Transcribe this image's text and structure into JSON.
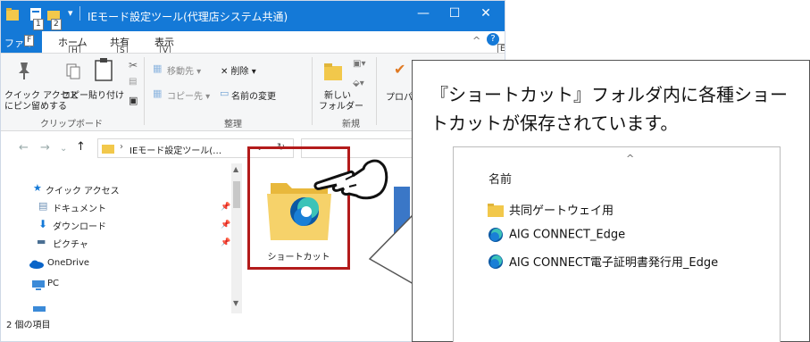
{
  "window": {
    "title": "IEモード設定ツール(代理店システム共通)",
    "qat_keytips": [
      "1",
      "2"
    ],
    "controls": [
      "—",
      "☐",
      "✕"
    ],
    "help_keytip": "E"
  },
  "ribbon_tabs": {
    "file": {
      "label": "ファイル",
      "keytip": "F"
    },
    "home": {
      "label": "ホーム",
      "keytip": "H"
    },
    "share": {
      "label": "共有",
      "keytip": "S"
    },
    "view": {
      "label": "表示",
      "keytip": "V"
    }
  },
  "ribbon": {
    "pin_quick_access": [
      "クイック アクセス",
      "にピン留めする"
    ],
    "copy": "コピー",
    "paste": "貼り付け",
    "move_to": "移動先 ▾",
    "delete": "✕ 削除 ▾",
    "copy_to": "コピー先 ▾",
    "rename": "名前の変更",
    "new_folder": [
      "新しい",
      "フォルダー"
    ],
    "properties": "プロパ",
    "group_clipboard": "クリップボード",
    "group_organize": "整理",
    "group_new": "新規"
  },
  "address": {
    "path": "IEモード設定ツール(…",
    "dropdown": "⌄",
    "refresh": "↻"
  },
  "nav": {
    "quick_access": "クイック アクセス",
    "documents": "ドキュメント",
    "downloads": "ダウンロード",
    "pictures": "ピクチャ",
    "onedrive": "OneDrive",
    "pc": "PC"
  },
  "content": {
    "folder_name": "ショートカット"
  },
  "status": {
    "item_count": "2 個の項目"
  },
  "callout": {
    "text": "『ショートカット』フォルダ内に各種ショートカットが保存されています。",
    "column_header": "名前",
    "items": [
      {
        "name": "共同ゲートウェイ用",
        "icon": "folder-icon"
      },
      {
        "name": "AIG CONNECT_Edge",
        "icon": "edge-icon"
      },
      {
        "name": "AIG CONNECT電子証明書発行用_Edge",
        "icon": "edge-icon"
      }
    ]
  },
  "colors": {
    "title_blue": "#1479d7",
    "highlight_red": "#b31b1b",
    "folder_yellow": "#f2c84b"
  }
}
